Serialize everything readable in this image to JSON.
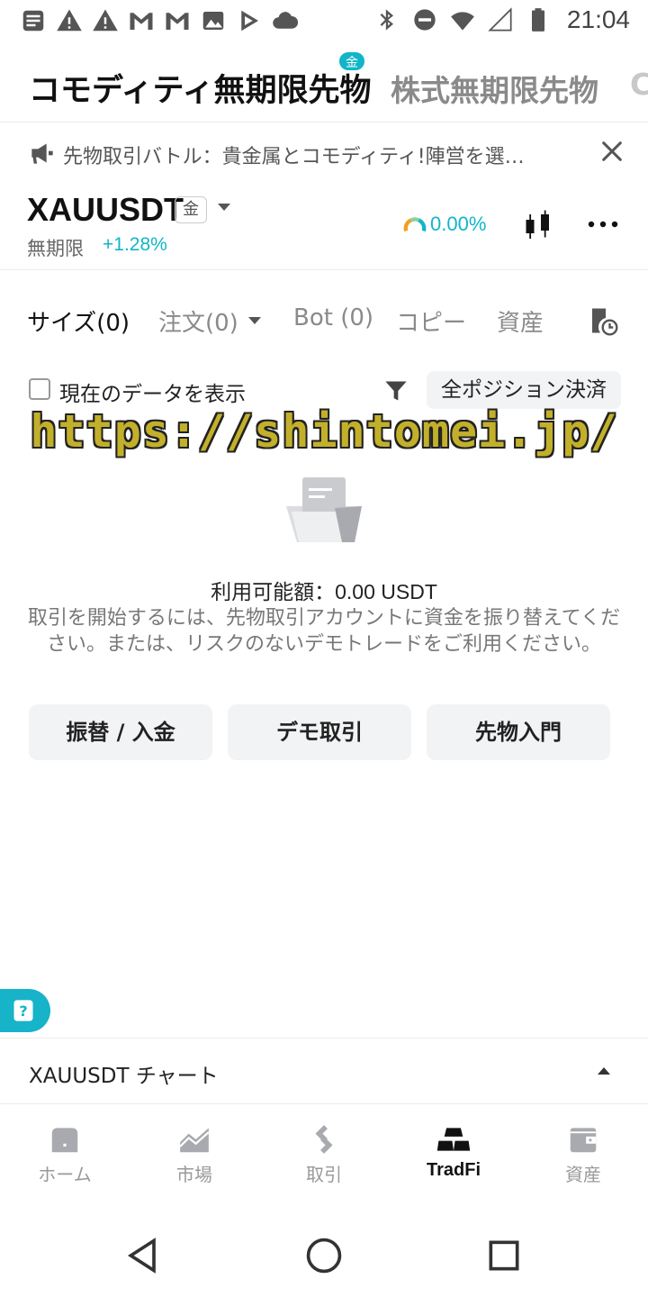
{
  "status_bar": {
    "time": "21:04",
    "left_icons": [
      "notification-list-icon",
      "warning-icon",
      "warning-icon",
      "gmail-icon",
      "gmail-icon",
      "image-icon",
      "play-store-icon",
      "cloud-icon"
    ],
    "right_icons": [
      "bluetooth-icon",
      "do-not-disturb-icon",
      "wifi-icon",
      "cell-signal-icon",
      "battery-icon"
    ]
  },
  "top_tabs": {
    "active": "コモディティ無期限先物",
    "active_badge": "金",
    "inactive": "株式無期限先物",
    "more": "C"
  },
  "announcement": {
    "text": "先物取引バトル：貴金属とコモディティ!陣営を選…"
  },
  "symbol": {
    "name": "XAUUSDT",
    "badge": "金",
    "type": "無期限",
    "change": "+1.28%",
    "funding_rate": "0.00%"
  },
  "sub_tabs": {
    "position": "サイズ(0)",
    "orders": "注文(0)",
    "bot": "Bot (0)",
    "copy": "コピー",
    "assets": "資産"
  },
  "filter": {
    "checkbox_label": "現在のデータを表示",
    "close_all": "全ポジション決済"
  },
  "watermark": "https://shintomei.jp/",
  "empty_state": {
    "available_label": "利用可能額：",
    "available_value": "0.00 USDT",
    "description": "取引を開始するには、先物取引アカウントに資金を振り替えてください。または、リスクのないデモトレードをご利用ください。"
  },
  "actions": {
    "transfer": "振替 / 入金",
    "demo": "デモ取引",
    "intro": "先物入門"
  },
  "chart_row": {
    "label": "XAUUSDT チャート"
  },
  "bottom_nav": {
    "home": "ホーム",
    "markets": "市場",
    "trade": "取引",
    "tradfi": "TradFi",
    "assets": "資産"
  },
  "colors": {
    "accent": "#11b5c8",
    "text_primary": "#111111",
    "text_muted": "#8a8a8a",
    "button_bg": "#f2f3f5"
  }
}
